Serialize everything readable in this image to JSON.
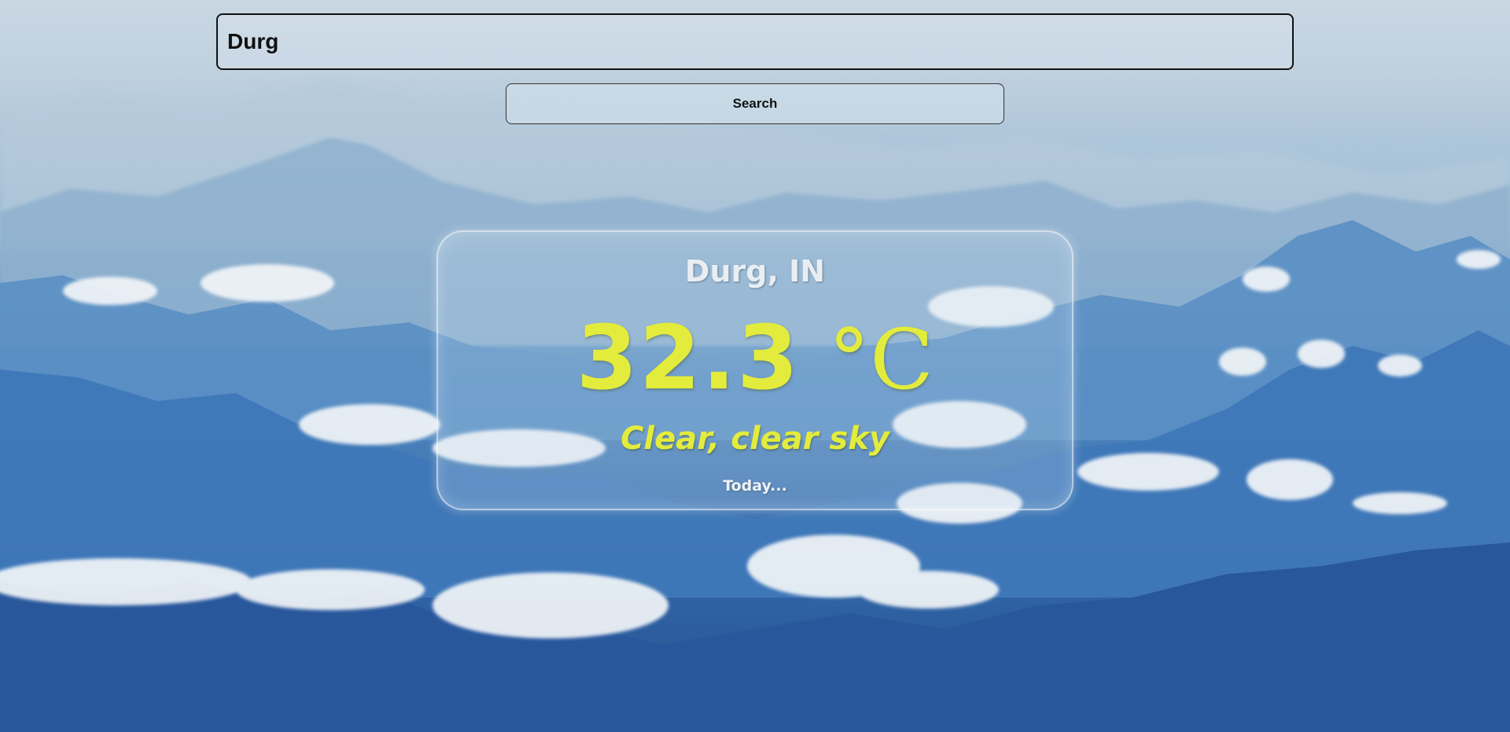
{
  "search": {
    "value": "Durg",
    "button_label": "Search"
  },
  "weather": {
    "location": "Durg, IN",
    "temperature": "32.3",
    "unit": "°C",
    "description": "Clear, clear sky",
    "day_label": "Today..."
  },
  "colors": {
    "accent": "#e3ec3c",
    "location_text": "#e9eef3",
    "sky_top": "#c9d7e3",
    "sky_bottom": "#24528f"
  },
  "background": {
    "scene": "misty blue mountain ranges with clouds"
  }
}
